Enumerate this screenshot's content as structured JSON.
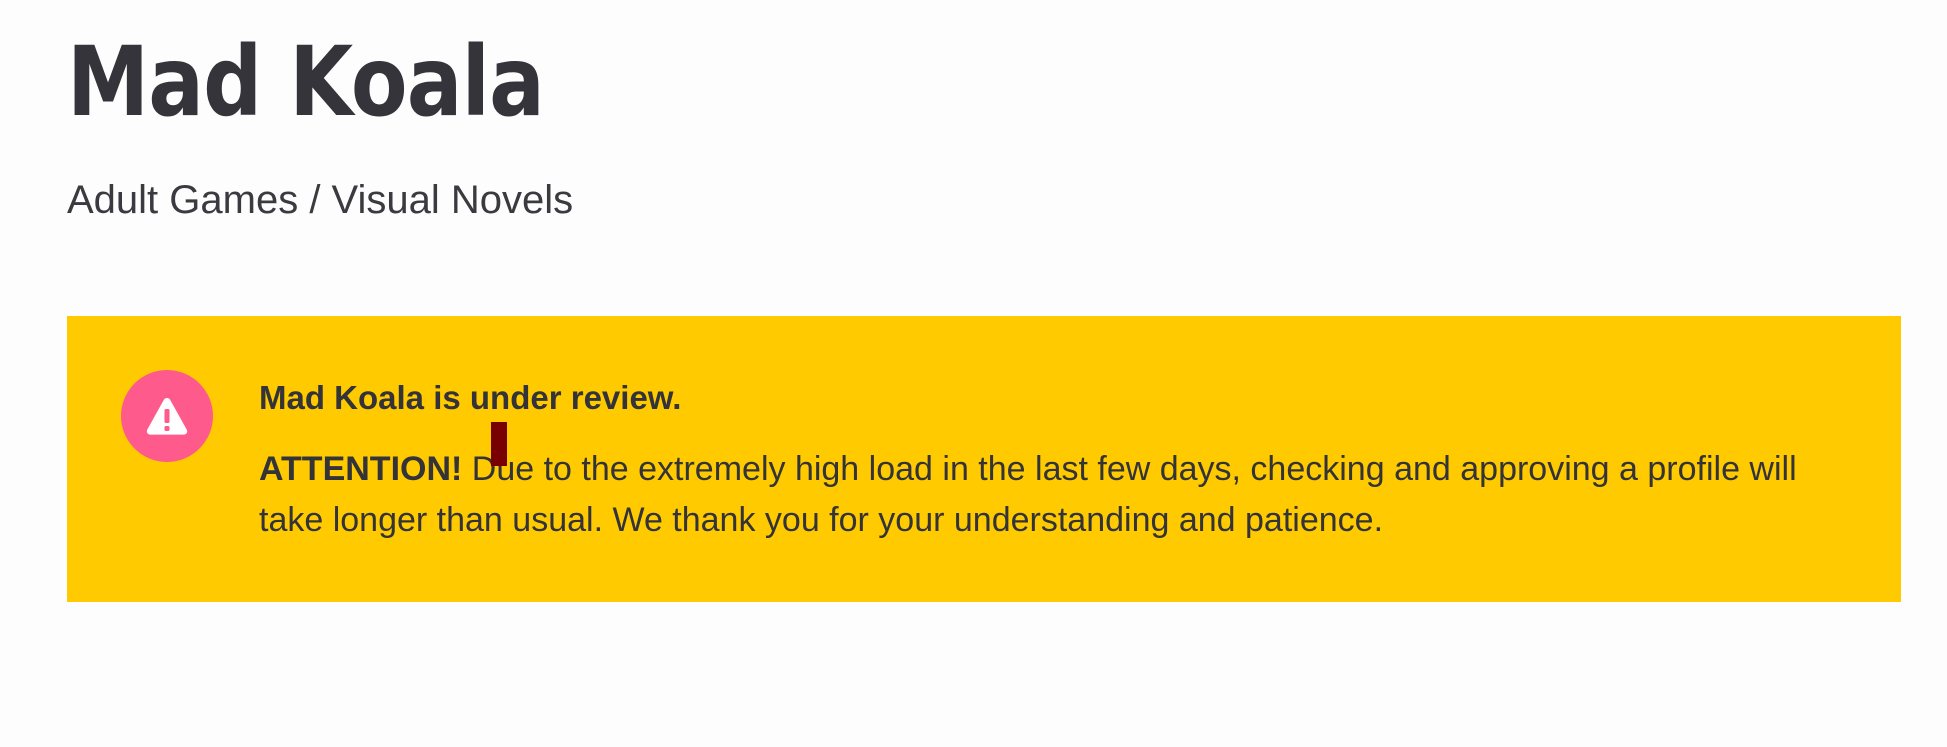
{
  "header": {
    "title": "Mad Koala",
    "subtitle": "Adult Games / Visual Novels"
  },
  "banner": {
    "background_color": "#ffca00",
    "icon": "warning-triangle-icon",
    "icon_color": "#ff5a8c",
    "heading": "Mad Koala is under review.",
    "attention_label": "ATTENTION!",
    "message": " Due to the extremely high load in the last few days, checking and approving a profile will take longer than usual. We thank you for your understanding and patience."
  },
  "cursor": {
    "color": "#780000"
  }
}
